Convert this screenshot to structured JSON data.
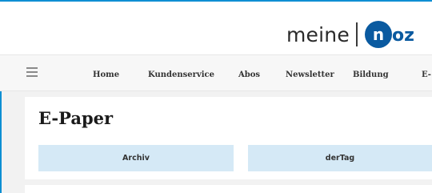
{
  "header": {
    "logo_text": "meine",
    "logo_mark": "noz",
    "brand_color": "#0a5aa0",
    "accent_color": "#0e8fd3"
  },
  "nav": {
    "menu_icon": "hamburger-menu-icon",
    "items": [
      "Home",
      "Kundenservice",
      "Abos",
      "Newsletter",
      "Bildung",
      "E-"
    ]
  },
  "main": {
    "title": "E-Paper",
    "tabs": [
      "Archiv",
      "derTag"
    ],
    "tab_color": "#d5e9f6"
  }
}
